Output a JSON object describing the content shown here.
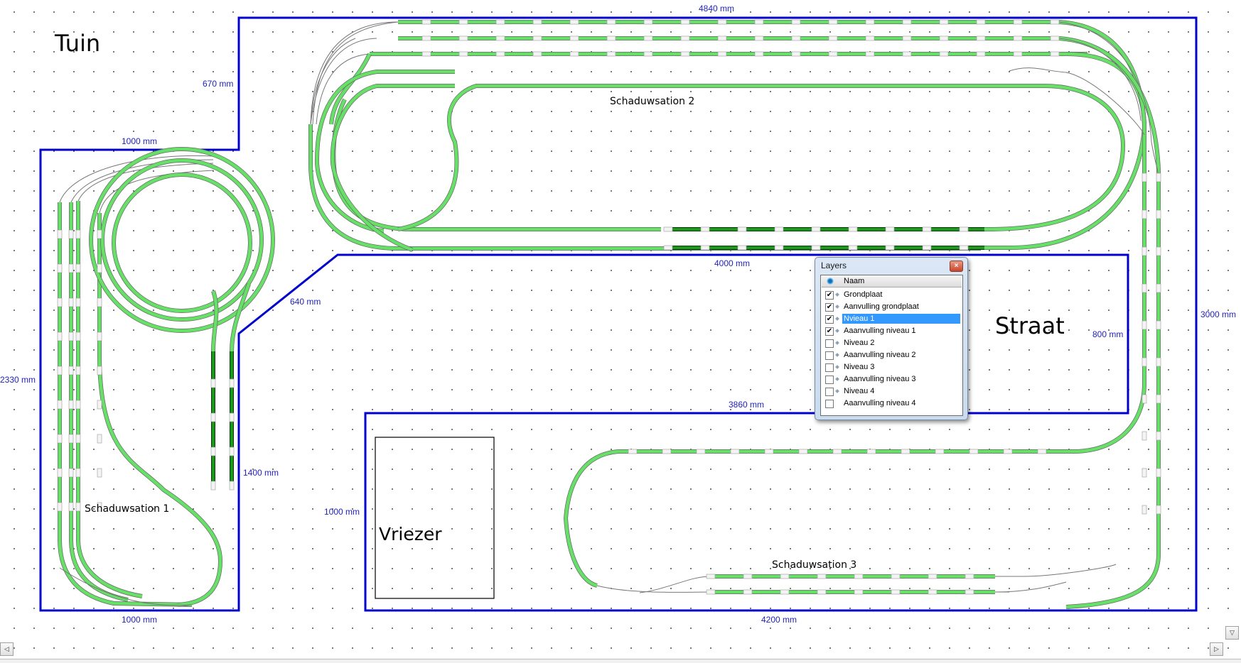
{
  "app": {
    "type": "model railway track planner"
  },
  "rooms": {
    "tuin": "Tuin",
    "straat": "Straat",
    "vriezer": "Vriezer"
  },
  "stations": {
    "s1": "Schaduwsation 1",
    "s2": "Schaduwsation 2",
    "s3": "Schaduwsation 3"
  },
  "dimensions": {
    "top": "4840 mm",
    "tuin_step": "670 mm",
    "left_top": "1000 mm",
    "left_side": "2330 mm",
    "left_bottom": "1000 mm",
    "diagonal": "640 mm",
    "inner_vertical": "1400 mm",
    "middle_top": "4000 mm",
    "middle_bottom": "3860 mm",
    "straat_right": "800 mm",
    "right_side": "3000 mm",
    "lower_left": "1000 mm",
    "bottom": "4200 mm"
  },
  "colors": {
    "outline": "#0000cc",
    "track": "#66e066",
    "track_selected": "#1a9a1a",
    "dim_text": "#2222bb",
    "selection": "#3399ff"
  },
  "layers_panel": {
    "title": "Layers",
    "close_icon": "×",
    "column": "Naam",
    "items": [
      {
        "name": "Grondplaat",
        "checked": true,
        "selected": false
      },
      {
        "name": "Aanvulling grondplaat",
        "checked": true,
        "selected": false
      },
      {
        "name": "Nvieau 1",
        "checked": true,
        "selected": true
      },
      {
        "name": "Aaanvulling niveau 1",
        "checked": true,
        "selected": false
      },
      {
        "name": "Niveau 2",
        "checked": false,
        "selected": false
      },
      {
        "name": "Aaanvulling niveau 2",
        "checked": false,
        "selected": false
      },
      {
        "name": "Niveau 3",
        "checked": false,
        "selected": false
      },
      {
        "name": "Aaanvulling niveau 3",
        "checked": false,
        "selected": false
      },
      {
        "name": "Niveau 4",
        "checked": false,
        "selected": false
      },
      {
        "name": "Aaanvulling niveau 4",
        "checked": false,
        "selected": false
      }
    ]
  },
  "scroll": {
    "down": "▽",
    "left": "◁",
    "right": "▷"
  }
}
